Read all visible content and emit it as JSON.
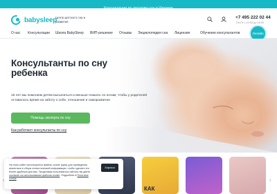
{
  "topbar": {
    "link": "Консультации по детскому сну в Израиле"
  },
  "brand": {
    "name": "babysleep",
    "tagline": "Центр детского сна и развития"
  },
  "contacts": {
    "phone": "+7 495 222 02 44",
    "hours": "Пн-Пт с 10:00 до 18:00"
  },
  "icons": {
    "search": "search-icon",
    "account": "user-icon",
    "logo": "moon-logo-icon",
    "arrow_left": "arrow-left-icon",
    "arrow_right": "arrow-right-icon"
  },
  "nav": {
    "items": [
      {
        "label": "О нас"
      },
      {
        "label": "Консультации"
      },
      {
        "label": "Школа BabySleep"
      },
      {
        "label": "ВИП-решение"
      },
      {
        "label": "Отзывы"
      },
      {
        "label": "Энциклопедия сна"
      },
      {
        "label": "Лицензия"
      },
      {
        "label": "Обучение консультантов"
      }
    ],
    "online_badge": "Онлайн"
  },
  "hero": {
    "title": "Консультанты по сну ребенка",
    "description": "15 лет мы помогаем детям высыпаться и меньше плакать по ночам, чтобы у родителей оставалось время на заботу о себе, отношения и саморазвитие.",
    "cta": "Помощь эксперта по сну",
    "how_link": "Как работают консультанты по сну"
  },
  "tiles": {
    "t4_label": "КАК"
  },
  "cookie": {
    "text_1": "На этом сайте используются файлы cookie (куки) для проведения аналитики и сбора статистической информации, чтобы сделать его более удобным для вас. Продолжая пользоваться сайтом, вы даете",
    "link": "согласие на использование файлов cookie",
    "text_2": ". Подробнее в",
    "policy": "Политике cookie",
    "button": "Хорошо"
  },
  "colors": {
    "accent": "#18b9c7",
    "cta": "#5bb85f",
    "text": "#1f2a33"
  }
}
